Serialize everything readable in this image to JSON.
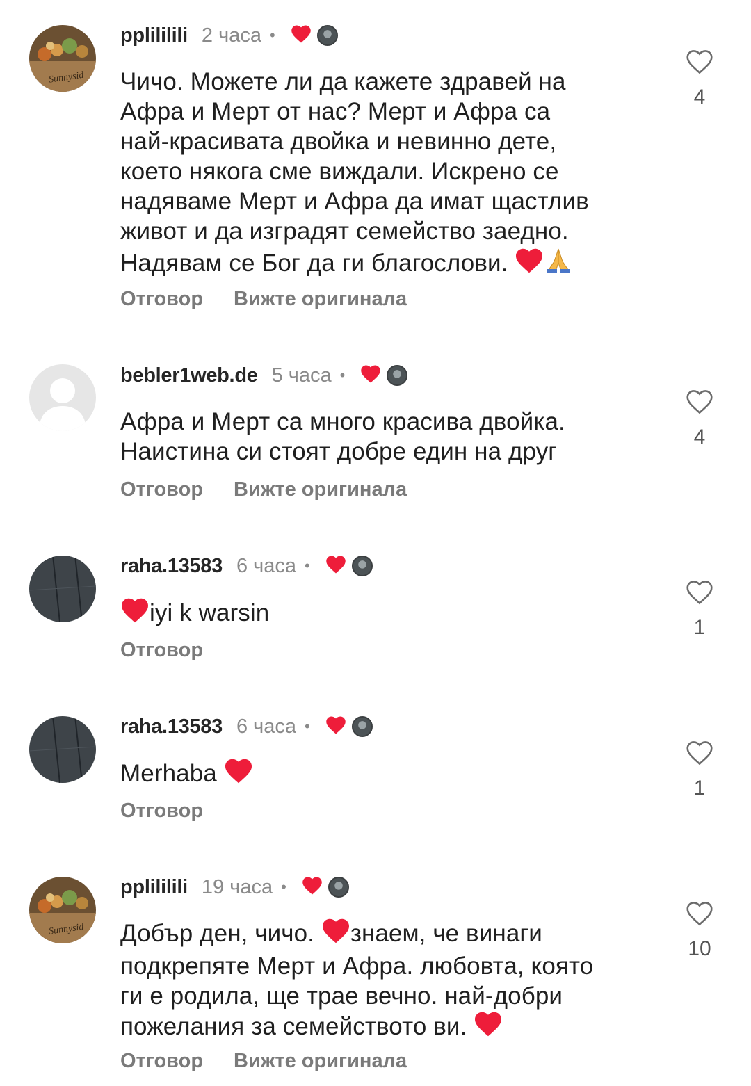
{
  "comments": [
    {
      "username": "pplililili",
      "time": "2 часа",
      "text": "Чичо. Можете ли да кажете здравей на\nАфра и Мерт от нас? Мерт и Афра са\nнай-красивата двойка и невинно дете,\nкоето някога сме виждали. Искрено се\nнадяваме Мерт и Афра да имат щастлив\nживот и да изградят семейство заедно.\nНадявам се Бог да ги благослови. ",
      "trailing_emojis": [
        "red-heart",
        "praying-hands"
      ],
      "likes": "4",
      "reply": "Отговор",
      "see_original": "Вижте оригинала",
      "avatar": "sunnyside-figurines",
      "avatar_caption": "Sunnysid"
    },
    {
      "username": "bebler1web.de",
      "time": "5 часа",
      "text": "Афра и Мерт са много красива двойка.\nНаистина си стоят добре един на друг",
      "likes": "4",
      "reply": "Отговор",
      "see_original": "Вижте оригинала",
      "avatar": "default-profile"
    },
    {
      "username": "raha.13583",
      "time": "6 часа",
      "leading_emoji": "red-heart",
      "text": "iyi k warsin",
      "likes": "1",
      "reply": "Отговор",
      "avatar": "dark-sky-wires"
    },
    {
      "username": "raha.13583",
      "time": "6 часа",
      "text": "Merhaba ",
      "trailing_emojis": [
        "red-heart"
      ],
      "likes": "1",
      "reply": "Отговор",
      "avatar": "dark-sky-wires"
    },
    {
      "username": "pplililili",
      "time": "19 часа",
      "text_part1": "Добър ден, чичо. ",
      "mid_emoji": "red-heart",
      "text_part2": "знаем, че винаги\nподкрепяте Мерт и Афра. любовта, която\nги е родила, ще трае вечно. най-добри\nпожелания за семейството ви. ",
      "trailing_emojis": [
        "red-heart"
      ],
      "likes": "10",
      "reply": "Отговор",
      "see_original": "Вижте оригинала",
      "avatar": "sunnyside-figurines",
      "avatar_caption": "Sunnysid"
    }
  ],
  "colors": {
    "heart_red": "#ee1d3a",
    "muted_text": "#8a8a8a",
    "action_text": "#7a7a7a",
    "like_outline": "#6b6b6b"
  }
}
